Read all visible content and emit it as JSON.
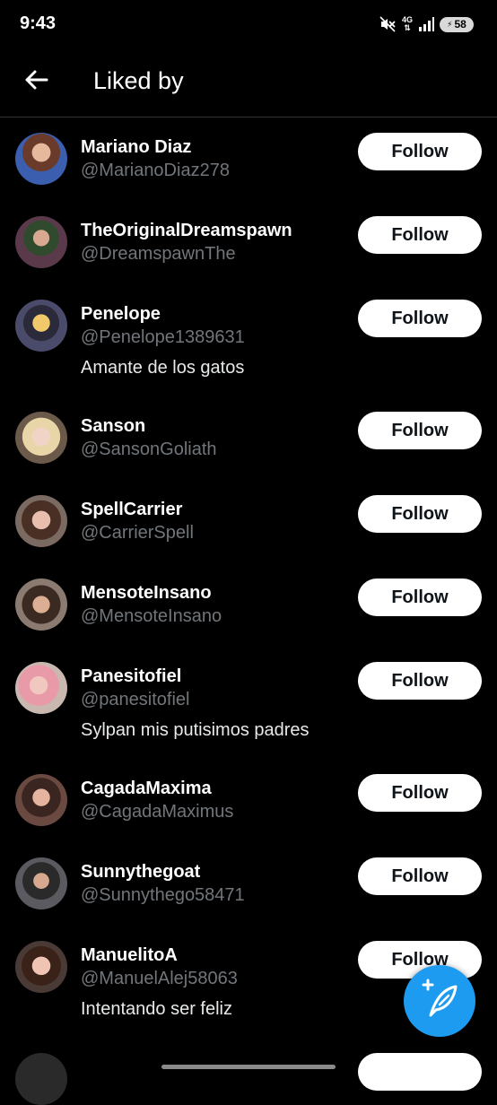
{
  "status_bar": {
    "time": "9:43",
    "network": "4G",
    "battery_level": "58",
    "icons": [
      "mute-icon",
      "network-icon",
      "signal-icon",
      "battery-icon"
    ]
  },
  "header": {
    "title": "Liked by",
    "back_icon": "arrow-left-icon"
  },
  "follow_label": "Follow",
  "users": [
    {
      "name": "Mariano Diaz",
      "handle": "@MarianoDiaz278",
      "bio": ""
    },
    {
      "name": "TheOriginalDreamspawn",
      "handle": "@DreamspawnThe",
      "bio": ""
    },
    {
      "name": "Penelope",
      "handle": "@Penelope1389631",
      "bio": "Amante de los gatos"
    },
    {
      "name": "Sanson",
      "handle": "@SansonGoliath",
      "bio": ""
    },
    {
      "name": "SpellCarrier",
      "handle": "@CarrierSpell",
      "bio": ""
    },
    {
      "name": "MensoteInsano",
      "handle": "@MensoteInsano",
      "bio": ""
    },
    {
      "name": "Panesitofiel",
      "handle": "@panesitofiel",
      "bio": "Sylpan mis putisimos padres"
    },
    {
      "name": "CagadaMaxima",
      "handle": "@CagadaMaximus",
      "bio": ""
    },
    {
      "name": "Sunnythegoat",
      "handle": "@Sunnythego58471",
      "bio": ""
    },
    {
      "name": "ManuelitoA",
      "handle": "@ManuelAlej58063",
      "bio": "Intentando ser feliz"
    }
  ],
  "fab": {
    "icon": "compose-post-icon"
  },
  "colors": {
    "background": "#000000",
    "handle": "#71767b",
    "accent": "#1d9bf0",
    "button_bg": "#ffffff",
    "button_text": "#0f1419"
  }
}
